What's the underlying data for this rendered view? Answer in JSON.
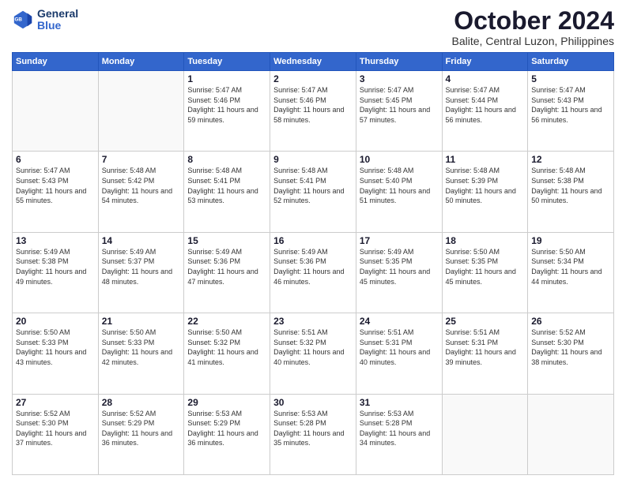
{
  "header": {
    "logo_line1": "General",
    "logo_line2": "Blue",
    "month": "October 2024",
    "location": "Balite, Central Luzon, Philippines"
  },
  "weekdays": [
    "Sunday",
    "Monday",
    "Tuesday",
    "Wednesday",
    "Thursday",
    "Friday",
    "Saturday"
  ],
  "weeks": [
    [
      {
        "day": "",
        "info": ""
      },
      {
        "day": "",
        "info": ""
      },
      {
        "day": "1",
        "info": "Sunrise: 5:47 AM\nSunset: 5:46 PM\nDaylight: 11 hours and 59 minutes."
      },
      {
        "day": "2",
        "info": "Sunrise: 5:47 AM\nSunset: 5:46 PM\nDaylight: 11 hours and 58 minutes."
      },
      {
        "day": "3",
        "info": "Sunrise: 5:47 AM\nSunset: 5:45 PM\nDaylight: 11 hours and 57 minutes."
      },
      {
        "day": "4",
        "info": "Sunrise: 5:47 AM\nSunset: 5:44 PM\nDaylight: 11 hours and 56 minutes."
      },
      {
        "day": "5",
        "info": "Sunrise: 5:47 AM\nSunset: 5:43 PM\nDaylight: 11 hours and 56 minutes."
      }
    ],
    [
      {
        "day": "6",
        "info": "Sunrise: 5:47 AM\nSunset: 5:43 PM\nDaylight: 11 hours and 55 minutes."
      },
      {
        "day": "7",
        "info": "Sunrise: 5:48 AM\nSunset: 5:42 PM\nDaylight: 11 hours and 54 minutes."
      },
      {
        "day": "8",
        "info": "Sunrise: 5:48 AM\nSunset: 5:41 PM\nDaylight: 11 hours and 53 minutes."
      },
      {
        "day": "9",
        "info": "Sunrise: 5:48 AM\nSunset: 5:41 PM\nDaylight: 11 hours and 52 minutes."
      },
      {
        "day": "10",
        "info": "Sunrise: 5:48 AM\nSunset: 5:40 PM\nDaylight: 11 hours and 51 minutes."
      },
      {
        "day": "11",
        "info": "Sunrise: 5:48 AM\nSunset: 5:39 PM\nDaylight: 11 hours and 50 minutes."
      },
      {
        "day": "12",
        "info": "Sunrise: 5:48 AM\nSunset: 5:38 PM\nDaylight: 11 hours and 50 minutes."
      }
    ],
    [
      {
        "day": "13",
        "info": "Sunrise: 5:49 AM\nSunset: 5:38 PM\nDaylight: 11 hours and 49 minutes."
      },
      {
        "day": "14",
        "info": "Sunrise: 5:49 AM\nSunset: 5:37 PM\nDaylight: 11 hours and 48 minutes."
      },
      {
        "day": "15",
        "info": "Sunrise: 5:49 AM\nSunset: 5:36 PM\nDaylight: 11 hours and 47 minutes."
      },
      {
        "day": "16",
        "info": "Sunrise: 5:49 AM\nSunset: 5:36 PM\nDaylight: 11 hours and 46 minutes."
      },
      {
        "day": "17",
        "info": "Sunrise: 5:49 AM\nSunset: 5:35 PM\nDaylight: 11 hours and 45 minutes."
      },
      {
        "day": "18",
        "info": "Sunrise: 5:50 AM\nSunset: 5:35 PM\nDaylight: 11 hours and 45 minutes."
      },
      {
        "day": "19",
        "info": "Sunrise: 5:50 AM\nSunset: 5:34 PM\nDaylight: 11 hours and 44 minutes."
      }
    ],
    [
      {
        "day": "20",
        "info": "Sunrise: 5:50 AM\nSunset: 5:33 PM\nDaylight: 11 hours and 43 minutes."
      },
      {
        "day": "21",
        "info": "Sunrise: 5:50 AM\nSunset: 5:33 PM\nDaylight: 11 hours and 42 minutes."
      },
      {
        "day": "22",
        "info": "Sunrise: 5:50 AM\nSunset: 5:32 PM\nDaylight: 11 hours and 41 minutes."
      },
      {
        "day": "23",
        "info": "Sunrise: 5:51 AM\nSunset: 5:32 PM\nDaylight: 11 hours and 40 minutes."
      },
      {
        "day": "24",
        "info": "Sunrise: 5:51 AM\nSunset: 5:31 PM\nDaylight: 11 hours and 40 minutes."
      },
      {
        "day": "25",
        "info": "Sunrise: 5:51 AM\nSunset: 5:31 PM\nDaylight: 11 hours and 39 minutes."
      },
      {
        "day": "26",
        "info": "Sunrise: 5:52 AM\nSunset: 5:30 PM\nDaylight: 11 hours and 38 minutes."
      }
    ],
    [
      {
        "day": "27",
        "info": "Sunrise: 5:52 AM\nSunset: 5:30 PM\nDaylight: 11 hours and 37 minutes."
      },
      {
        "day": "28",
        "info": "Sunrise: 5:52 AM\nSunset: 5:29 PM\nDaylight: 11 hours and 36 minutes."
      },
      {
        "day": "29",
        "info": "Sunrise: 5:53 AM\nSunset: 5:29 PM\nDaylight: 11 hours and 36 minutes."
      },
      {
        "day": "30",
        "info": "Sunrise: 5:53 AM\nSunset: 5:28 PM\nDaylight: 11 hours and 35 minutes."
      },
      {
        "day": "31",
        "info": "Sunrise: 5:53 AM\nSunset: 5:28 PM\nDaylight: 11 hours and 34 minutes."
      },
      {
        "day": "",
        "info": ""
      },
      {
        "day": "",
        "info": ""
      }
    ]
  ]
}
